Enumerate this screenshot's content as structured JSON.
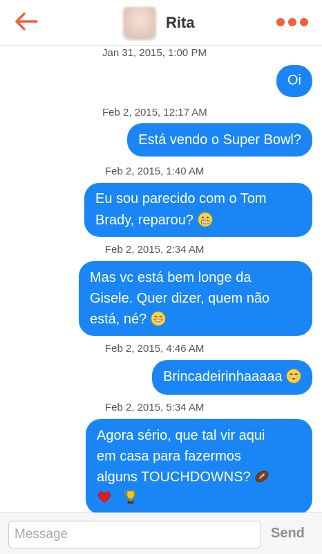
{
  "header": {
    "contact_name": "Rita",
    "accent_color": "#f0613f"
  },
  "messages": [
    {
      "timestamp": "Jan 31, 2015, 1:00 PM",
      "lines": [
        "Oi"
      ]
    },
    {
      "timestamp": "Feb 2, 2015, 12:17 AM",
      "lines": [
        "Está vendo o Super Bowl?"
      ]
    },
    {
      "timestamp": "Feb 2, 2015, 1:40 AM",
      "lines": [
        "Eu sou parecido com o Tom",
        "Brady, reparou?"
      ],
      "emoji": [
        "grimacing-face"
      ]
    },
    {
      "timestamp": "Feb 2, 2015, 2:34 AM",
      "lines": [
        "Mas vc está bem longe da",
        "Gisele. Quer dizer, quem não",
        "está, né?"
      ],
      "emoji": [
        "grinning-face"
      ]
    },
    {
      "timestamp": "Feb 2, 2015, 4:46 AM",
      "lines": [
        "Brincadeirinhaaaaa"
      ],
      "emoji": [
        "kissing-face"
      ]
    },
    {
      "timestamp": "Feb 2, 2015, 5:34 AM",
      "lines": [
        "Agora sério, que tal vir aqui",
        "em casa para fazermos",
        "alguns TOUCHDOWNS?"
      ],
      "emoji": [
        "football",
        "red-heart",
        "trophy"
      ]
    }
  ],
  "bubble_color": "#1a86f5",
  "composer": {
    "placeholder": "Message",
    "send_label": "Send"
  }
}
